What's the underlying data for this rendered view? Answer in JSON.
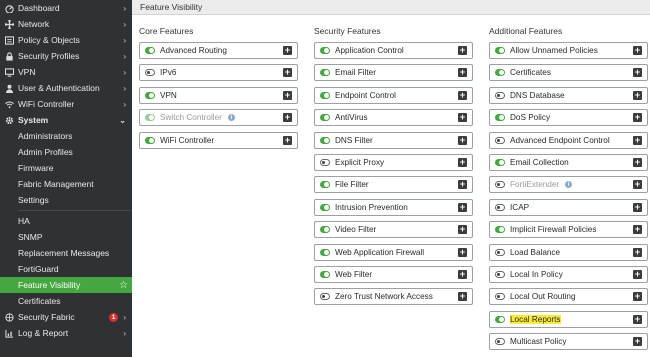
{
  "sidebar": {
    "items": [
      {
        "label": "Dashboard",
        "icon": "dashboard-icon",
        "chevron": true
      },
      {
        "label": "Network",
        "icon": "network-icon",
        "chevron": true
      },
      {
        "label": "Policy & Objects",
        "icon": "policy-icon",
        "chevron": true
      },
      {
        "label": "Security Profiles",
        "icon": "lock-icon",
        "chevron": true
      },
      {
        "label": "VPN",
        "icon": "monitor-icon",
        "chevron": true
      },
      {
        "label": "User & Authentication",
        "icon": "user-icon",
        "chevron": true
      },
      {
        "label": "WiFi Controller",
        "icon": "wifi-icon",
        "chevron": true
      },
      {
        "label": "System",
        "icon": "gear-icon",
        "chevron": "down"
      }
    ],
    "system_sub": [
      "Administrators",
      "Admin Profiles",
      "Firmware",
      "Fabric Management",
      "Settings"
    ],
    "system_sub2": [
      "HA",
      "SNMP",
      "Replacement Messages",
      "FortiGuard",
      "Feature Visibility",
      "Certificates"
    ],
    "security_fabric": {
      "label": "Security Fabric",
      "badge": "1"
    },
    "log_report": {
      "label": "Log & Report"
    }
  },
  "page": {
    "title": "Feature Visibility"
  },
  "columns": [
    {
      "title": "Core Features",
      "features": [
        {
          "label": "Advanced Routing",
          "on": true
        },
        {
          "label": "IPv6",
          "on": false
        },
        {
          "label": "VPN",
          "on": true
        },
        {
          "label": "Switch Controller",
          "on": true,
          "disabled": true,
          "info": true
        },
        {
          "label": "WiFi Controller",
          "on": true
        }
      ]
    },
    {
      "title": "Security Features",
      "features": [
        {
          "label": "Application Control",
          "on": true
        },
        {
          "label": "Email Filter",
          "on": true
        },
        {
          "label": "Endpoint Control",
          "on": true
        },
        {
          "label": "AntiVirus",
          "on": true
        },
        {
          "label": "DNS Filter",
          "on": true
        },
        {
          "label": "Explicit Proxy",
          "on": false
        },
        {
          "label": "File Filter",
          "on": true
        },
        {
          "label": "Intrusion Prevention",
          "on": true
        },
        {
          "label": "Video Filter",
          "on": true
        },
        {
          "label": "Web Application Firewall",
          "on": true
        },
        {
          "label": "Web Filter",
          "on": true
        },
        {
          "label": "Zero Trust Network Access",
          "on": false
        }
      ]
    },
    {
      "title": "Additional Features",
      "features": [
        {
          "label": "Allow Unnamed Policies",
          "on": true
        },
        {
          "label": "Certificates",
          "on": true
        },
        {
          "label": "DNS Database",
          "on": false
        },
        {
          "label": "DoS Policy",
          "on": true
        },
        {
          "label": "Advanced Endpoint Control",
          "on": false
        },
        {
          "label": "Email Collection",
          "on": true
        },
        {
          "label": "FortiExtender",
          "on": false,
          "disabled": true,
          "info": true
        },
        {
          "label": "ICAP",
          "on": false
        },
        {
          "label": "Implicit Firewall Policies",
          "on": true
        },
        {
          "label": "Load Balance",
          "on": false
        },
        {
          "label": "Local In Policy",
          "on": false
        },
        {
          "label": "Local Out Routing",
          "on": false
        },
        {
          "label": "Local Reports",
          "on": true,
          "highlight": true
        },
        {
          "label": "Multicast Policy",
          "on": false
        }
      ]
    }
  ],
  "colors": {
    "accent": "#44a73f",
    "sidebar_bg": "#2f3235",
    "highlight": "#f8ea3a",
    "badge": "#d9302c"
  }
}
